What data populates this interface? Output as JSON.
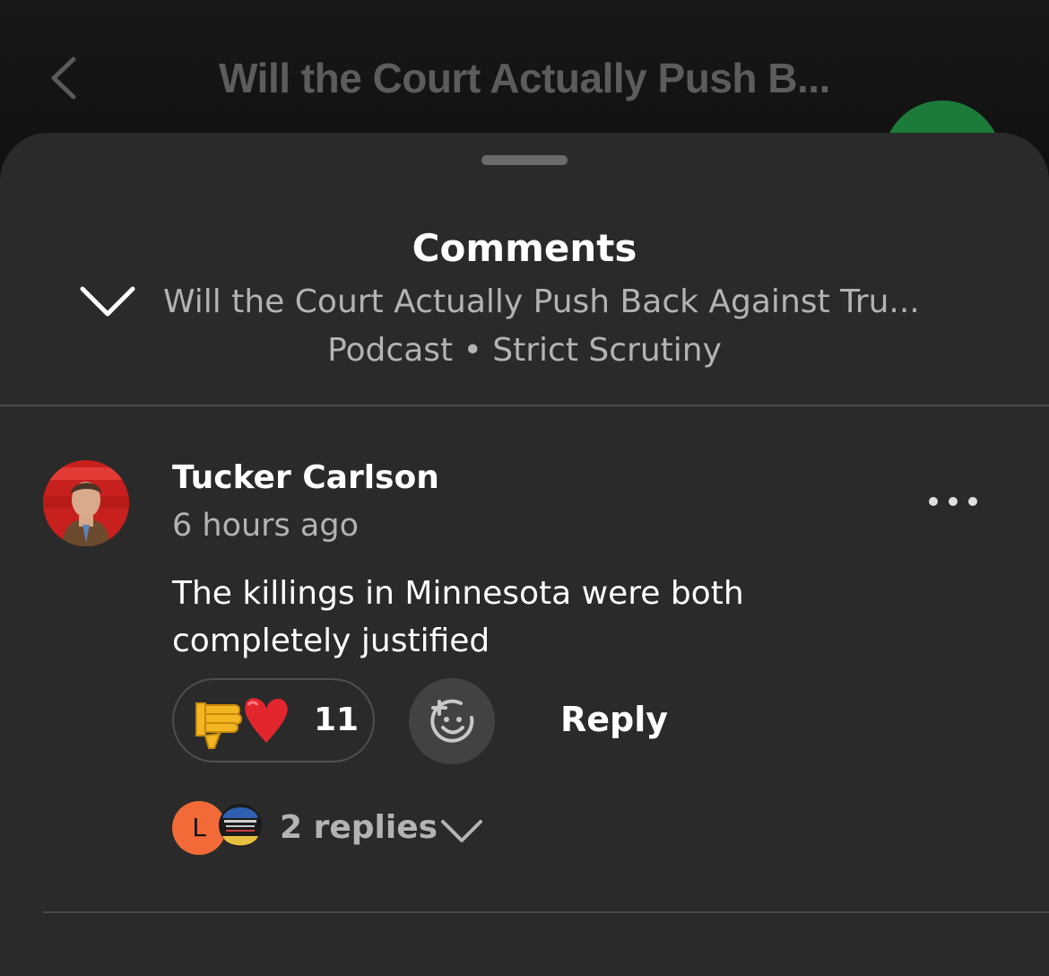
{
  "header": {
    "title": "Will the Court Actually Push B..."
  },
  "sheet": {
    "title": "Comments",
    "episode_title": "Will the Court Actually Push Back Against Tru...",
    "episode_meta": "Podcast • Strict Scrutiny"
  },
  "comment": {
    "author": "Tucker Carlson",
    "time": "6 hours ago",
    "text": "The killings in Minnesota were both completely justified",
    "reaction_emojis": "👎❤️",
    "reaction_count": "11",
    "reply_label": "Reply",
    "replies_label": "2 replies",
    "reply_avatar_initial": "L"
  },
  "icons": {
    "back": "chevron-left-icon",
    "collapse": "chevron-down-icon",
    "more": "more-horizontal-icon",
    "add_reaction": "add-emoji-icon",
    "expand_replies": "chevron-down-icon"
  },
  "colors": {
    "background": "#121212",
    "sheet": "#2a2a2a",
    "accent_green": "#1c7a3a",
    "avatar_orange": "#f26a38",
    "secondary_text": "#b3b3b3"
  }
}
